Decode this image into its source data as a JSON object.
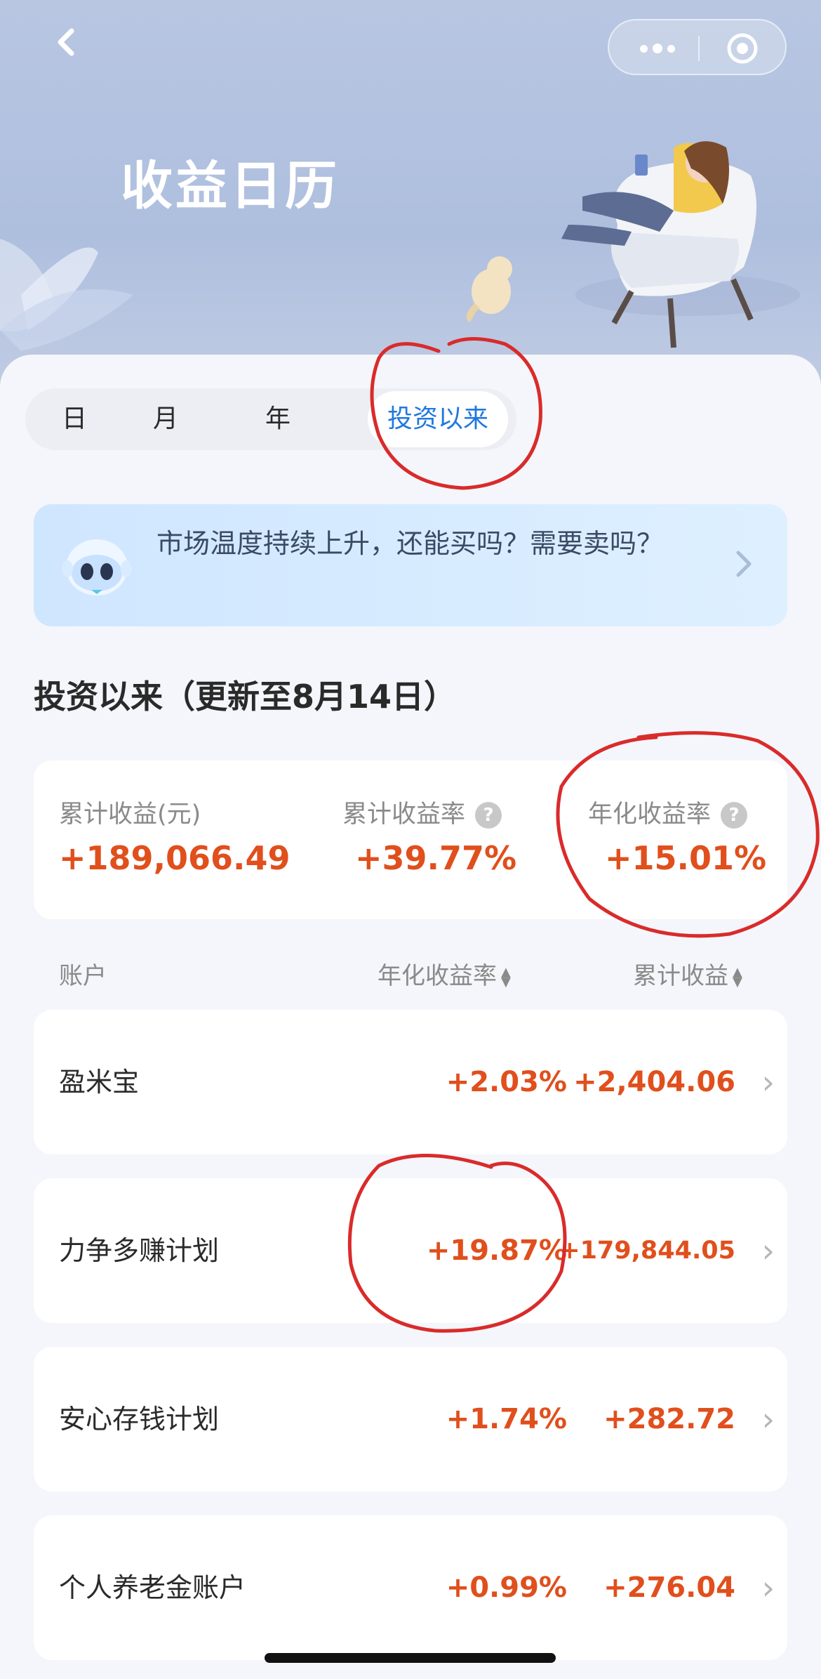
{
  "header": {
    "back_icon": "chevron-left-icon",
    "title": "收益日历",
    "menu_icon": "more-dots-icon",
    "close_icon": "target-circle-icon"
  },
  "tabs": [
    {
      "label": "日",
      "active": false
    },
    {
      "label": "月",
      "active": false
    },
    {
      "label": "年",
      "active": false
    },
    {
      "label": "投资以来",
      "active": true
    }
  ],
  "banner": {
    "icon": "robot-mascot-icon",
    "text": "市场温度持续上升，还能买吗？需要卖吗？",
    "chevron": "chevron-right-icon"
  },
  "section": {
    "title": "投资以来（更新至8月14日）"
  },
  "summary": {
    "cumulative_label": "累计收益(元)",
    "cumulative_value": "+189,066.49",
    "cumulative_rate_label": "累计收益率",
    "cumulative_rate_value": "+39.77%",
    "annual_rate_label": "年化收益率",
    "annual_rate_value": "+15.01%",
    "help_glyph": "?"
  },
  "list_header": {
    "account": "账户",
    "annual_rate": "年化收益率",
    "cumulative": "累计收益"
  },
  "accounts": [
    {
      "name": "盈米宝",
      "rate": "+2.03%",
      "total": "+2,404.06"
    },
    {
      "name": "力争多赚计划",
      "rate": "+19.87%",
      "total": "+179,844.05"
    },
    {
      "name": "安心存钱计划",
      "rate": "+1.74%",
      "total": "+282.72"
    },
    {
      "name": "个人养老金账户",
      "rate": "+0.99%",
      "total": "+276.04"
    }
  ],
  "colors": {
    "accent": "#1f78e0",
    "gain": "#e04f1c",
    "annotation": "#d92b2b"
  }
}
